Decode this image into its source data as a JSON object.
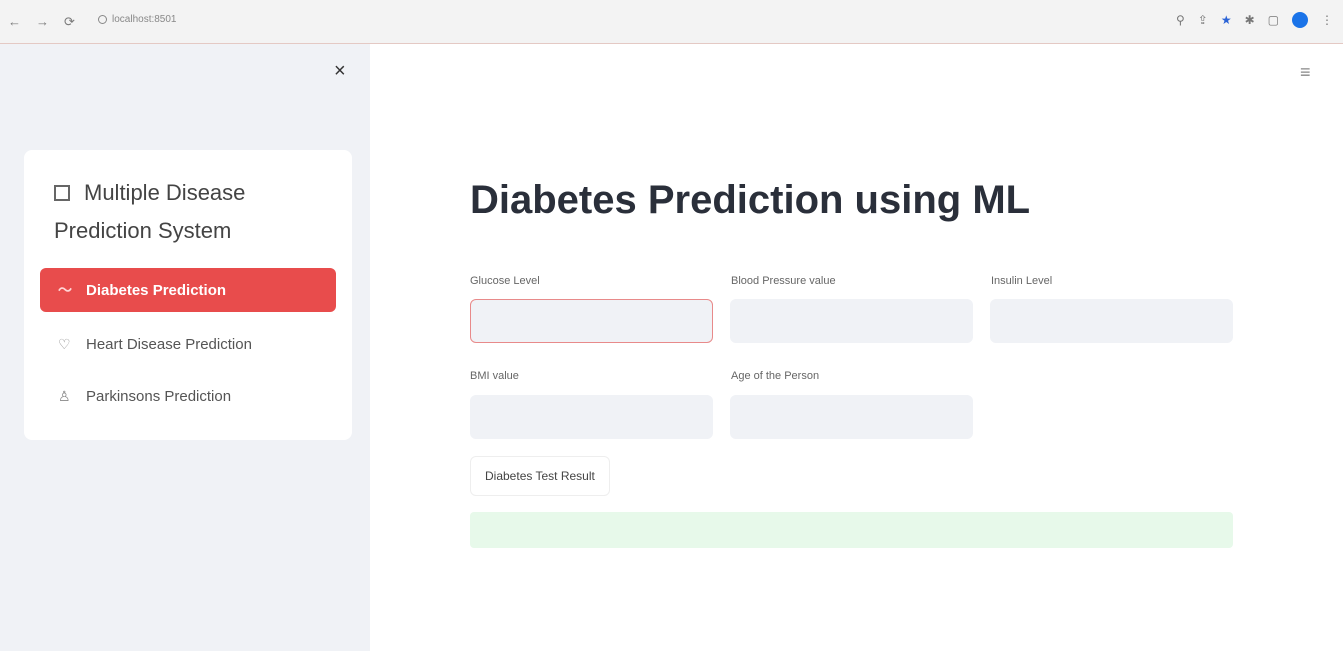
{
  "browser": {
    "url": "localhost:8501",
    "icons": [
      "search-icon",
      "share-icon",
      "star-icon",
      "extension-icon",
      "sidebar-icon",
      "profile-avatar",
      "menu-icon"
    ]
  },
  "sidebar": {
    "close_label": "×",
    "menu_title": "Multiple Disease Prediction System",
    "items": [
      {
        "label": "Diabetes Prediction",
        "icon": "activity-icon",
        "active": true
      },
      {
        "label": "Heart Disease Prediction",
        "icon": "heart-icon",
        "active": false
      },
      {
        "label": "Parkinsons Prediction",
        "icon": "person-icon",
        "active": false
      }
    ]
  },
  "main": {
    "menu_label": "≡",
    "title": "Diabetes Prediction using ML",
    "fields": {
      "glucose": {
        "label": "Glucose Level",
        "value": ""
      },
      "bp": {
        "label": "Blood Pressure value",
        "value": ""
      },
      "insulin": {
        "label": "Insulin Level",
        "value": ""
      },
      "bmi": {
        "label": "BMI value",
        "value": ""
      },
      "age": {
        "label": "Age of the Person",
        "value": ""
      }
    },
    "button_label": "Diabetes Test Result",
    "result_text": ""
  },
  "colors": {
    "accent": "#e84c4c",
    "sidebar_bg": "#f0f2f6",
    "result_bg": "#e7f9ea"
  }
}
